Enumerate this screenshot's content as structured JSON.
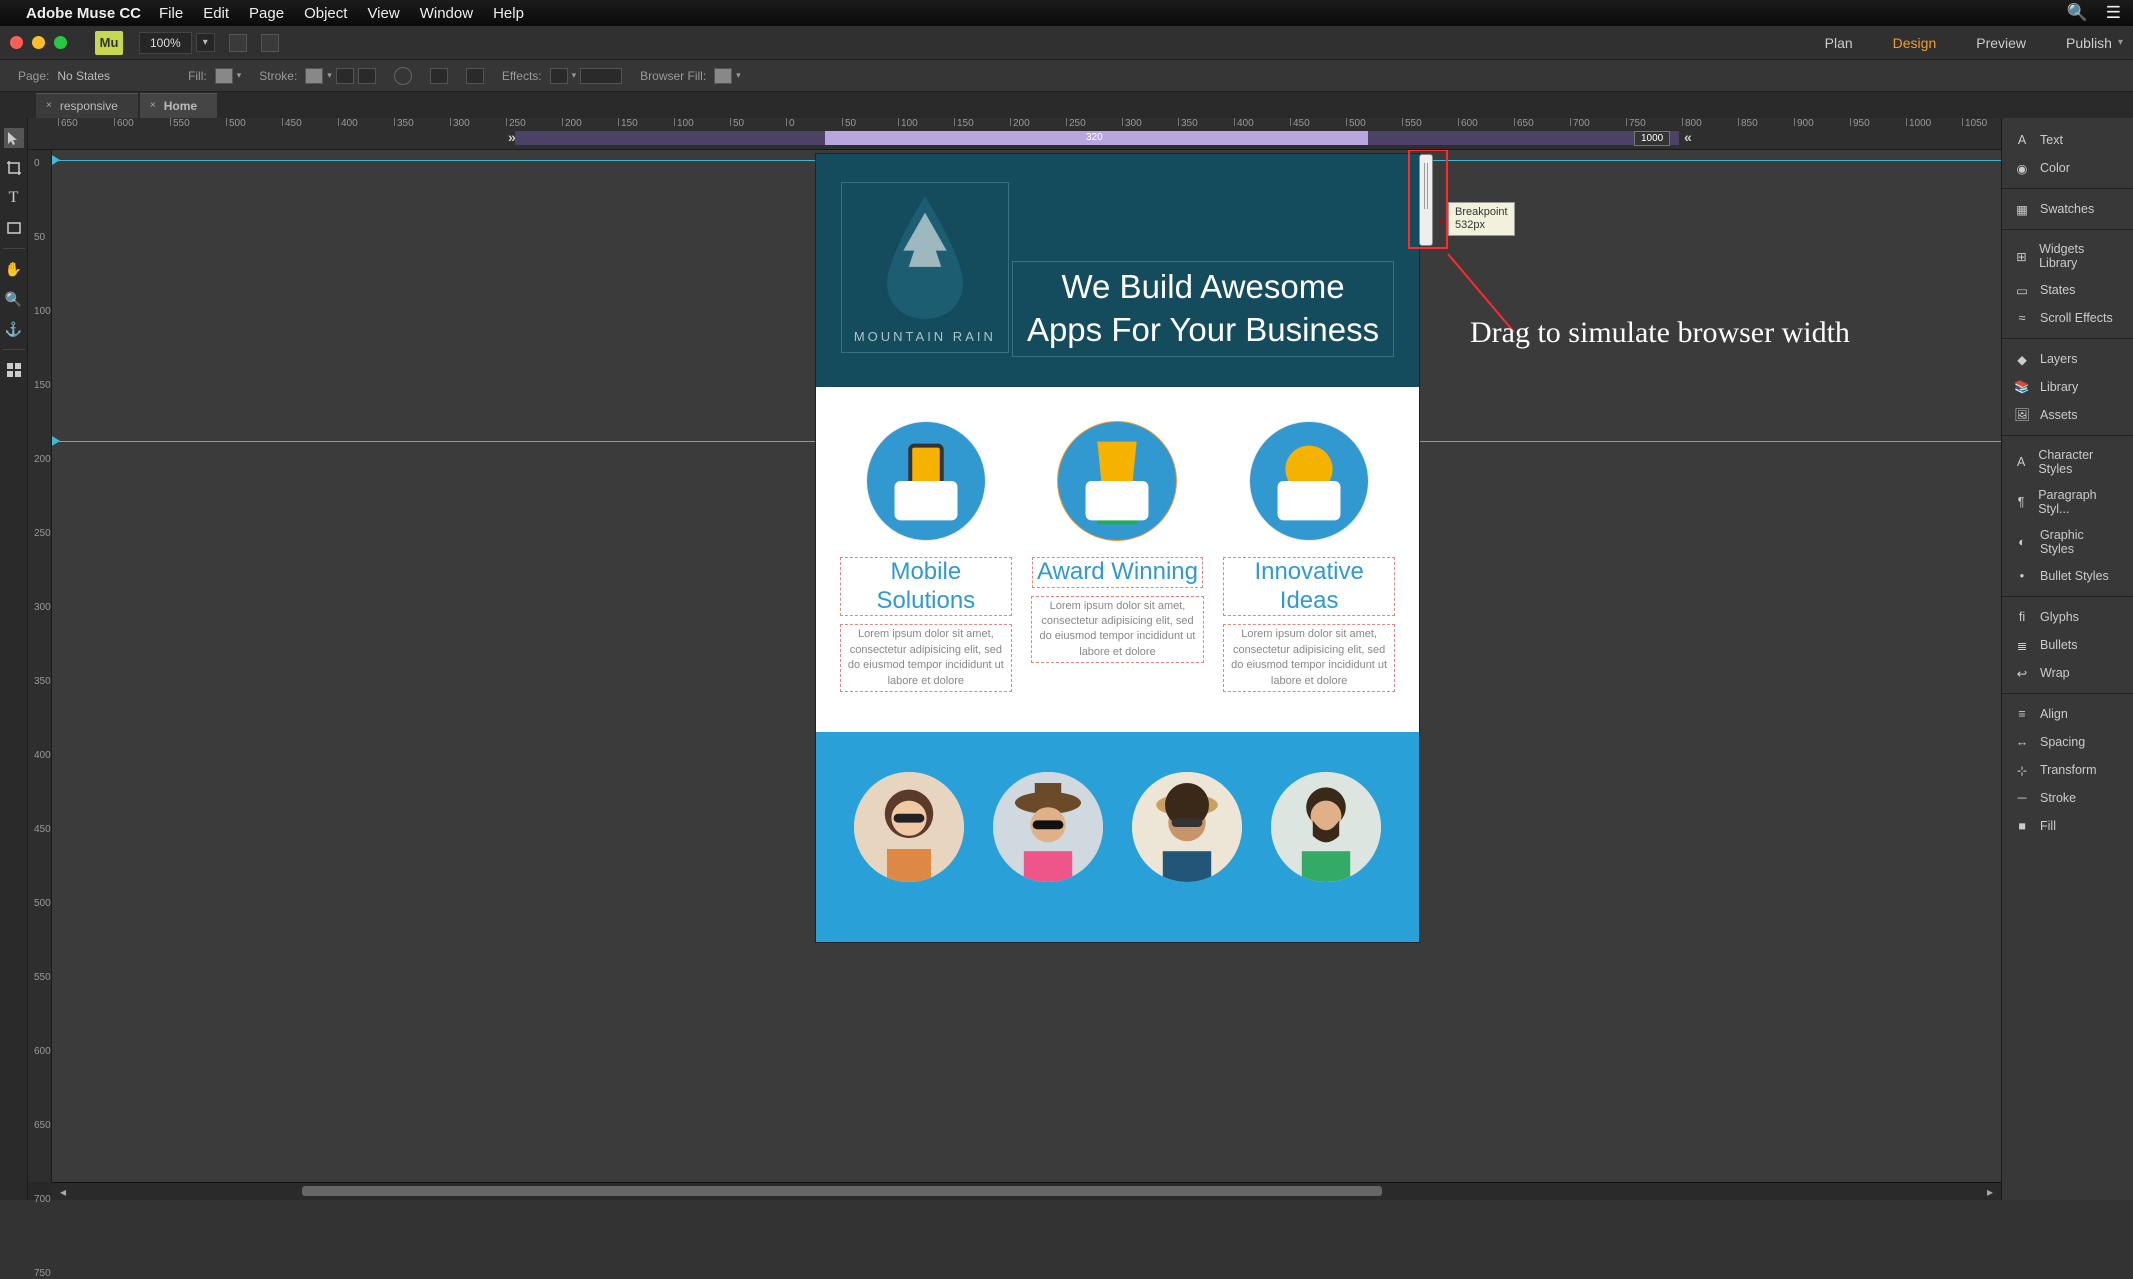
{
  "app": {
    "name": "Adobe Muse CC"
  },
  "menus": [
    "File",
    "Edit",
    "Page",
    "Object",
    "View",
    "Window",
    "Help"
  ],
  "zoom": "100%",
  "mode_tabs": {
    "plan": "Plan",
    "design": "Design",
    "preview": "Preview",
    "publish": "Publish"
  },
  "page_label": "Page:",
  "page_state": "No States",
  "fill_label": "Fill:",
  "stroke_label": "Stroke:",
  "effects_label": "Effects:",
  "browserfill_label": "Browser Fill:",
  "doc_tabs": [
    {
      "x": "×",
      "label": "responsive"
    },
    {
      "x": "×",
      "label": "Home"
    }
  ],
  "ruler_values": [
    "650",
    "600",
    "550",
    "500",
    "450",
    "400",
    "350",
    "300",
    "250",
    "200",
    "150",
    "100",
    "50",
    "0",
    "50",
    "100",
    "150",
    "200",
    "250",
    "300",
    "350",
    "400",
    "450",
    "500",
    "550",
    "600",
    "650",
    "700",
    "750",
    "800",
    "850",
    "900",
    "950",
    "1000",
    "1050"
  ],
  "breakpoints": {
    "center": "320",
    "max": "1000"
  },
  "ruler_left_values": [
    "0",
    "50",
    "100",
    "150",
    "200",
    "250",
    "300",
    "350",
    "400",
    "450",
    "500",
    "550",
    "600",
    "650",
    "700",
    "750"
  ],
  "scrubber": {
    "title": "Breakpoint",
    "value": "532px"
  },
  "annotation": "Drag to simulate browser width",
  "hero": {
    "logo": "MOUNTAIN RAIN",
    "headline_l1": "We Build Awesome",
    "headline_l2": "Apps For Your Business"
  },
  "feat_lorem": "Lorem ipsum dolor sit amet, consectetur adipisicing elit, sed do eiusmod tempor incididunt ut labore et dolore",
  "features": [
    {
      "title": "Mobile Solutions"
    },
    {
      "title": "Award Winning"
    },
    {
      "title": "Innovative Ideas"
    }
  ],
  "panels": [
    [
      "Text",
      "Color"
    ],
    [
      "Swatches"
    ],
    [
      "Widgets Library",
      "States",
      "Scroll Effects"
    ],
    [
      "Layers",
      "Library",
      "Assets"
    ],
    [
      "Character Styles",
      "Paragraph Styl...",
      "Graphic Styles",
      "Bullet Styles"
    ],
    [
      "Glyphs",
      "Bullets",
      "Wrap"
    ],
    [
      "Align",
      "Spacing",
      "Transform",
      "Stroke",
      "Fill"
    ]
  ]
}
